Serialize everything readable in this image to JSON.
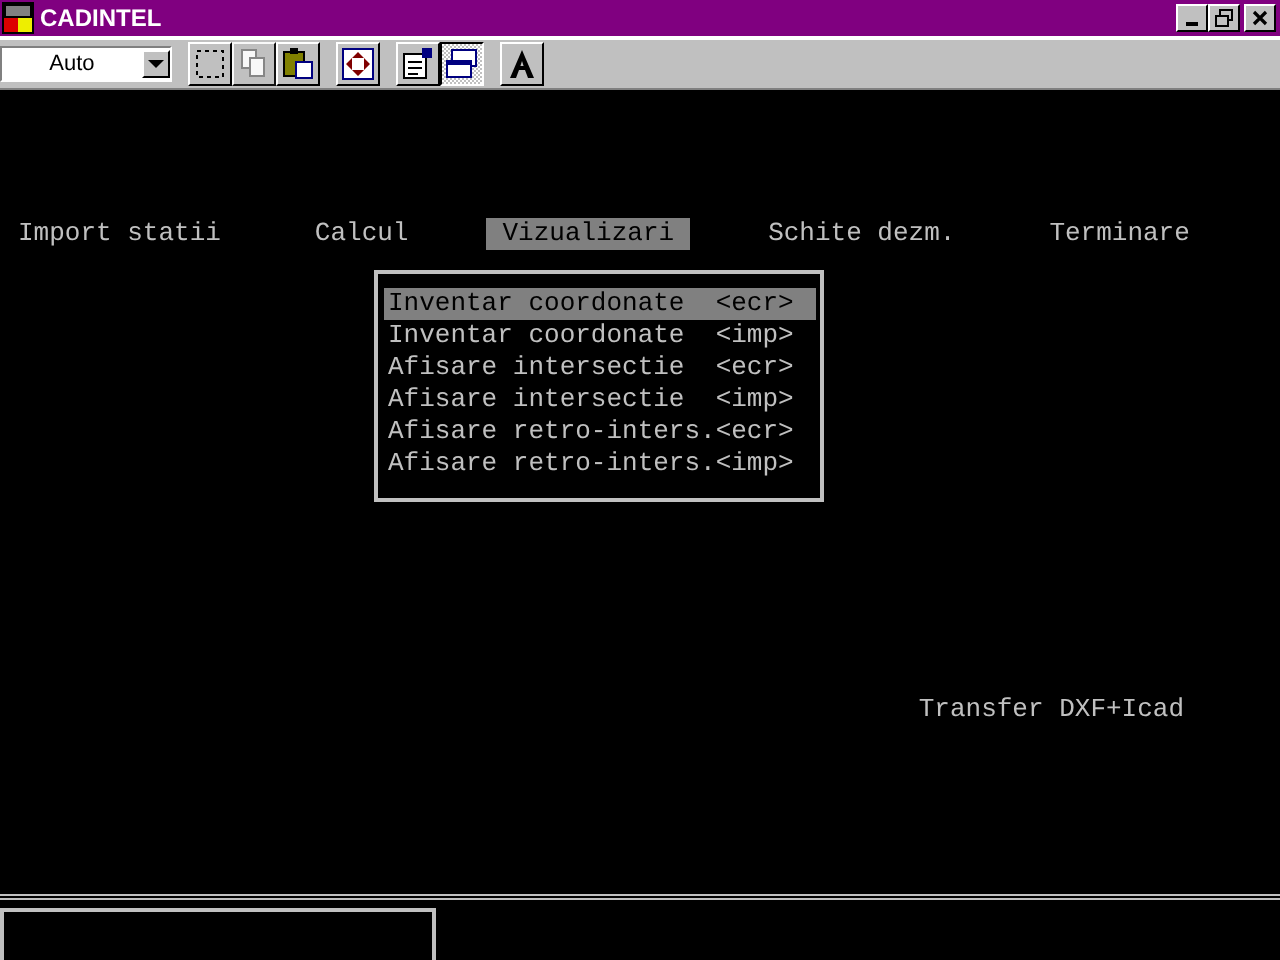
{
  "window": {
    "title": "CADINTEL"
  },
  "toolbar": {
    "font_size": "Auto",
    "buttons": [
      {
        "kind": "select",
        "pressed": false,
        "disabled": false
      },
      {
        "kind": "copy",
        "pressed": false,
        "disabled": true
      },
      {
        "kind": "paste",
        "pressed": false,
        "disabled": false
      },
      {
        "kind": "fullscreen",
        "pressed": false,
        "disabled": false
      },
      {
        "kind": "properties",
        "pressed": false,
        "disabled": false
      },
      {
        "kind": "background",
        "pressed": true,
        "disabled": false
      },
      {
        "kind": "font",
        "pressed": false,
        "disabled": false
      }
    ]
  },
  "menu": [
    {
      "label": "Import statii",
      "selected": false
    },
    {
      "label": "Calcul",
      "selected": false
    },
    {
      "label": "Vizualizari",
      "selected": true
    },
    {
      "label": "Schite dezm.",
      "selected": false
    },
    {
      "label": "Terminare",
      "selected": false
    }
  ],
  "submenu": [
    {
      "label": "Inventar coordonate  <ecr>",
      "selected": true
    },
    {
      "label": "Inventar coordonate  <imp>",
      "selected": false
    },
    {
      "label": "Afisare intersectie  <ecr>",
      "selected": false
    },
    {
      "label": "Afisare intersectie  <imp>",
      "selected": false
    },
    {
      "label": "Afisare retro-inters.<ecr>",
      "selected": false
    },
    {
      "label": "Afisare retro-inters.<imp>",
      "selected": false
    }
  ],
  "status": "Transfer DXF+Icad"
}
